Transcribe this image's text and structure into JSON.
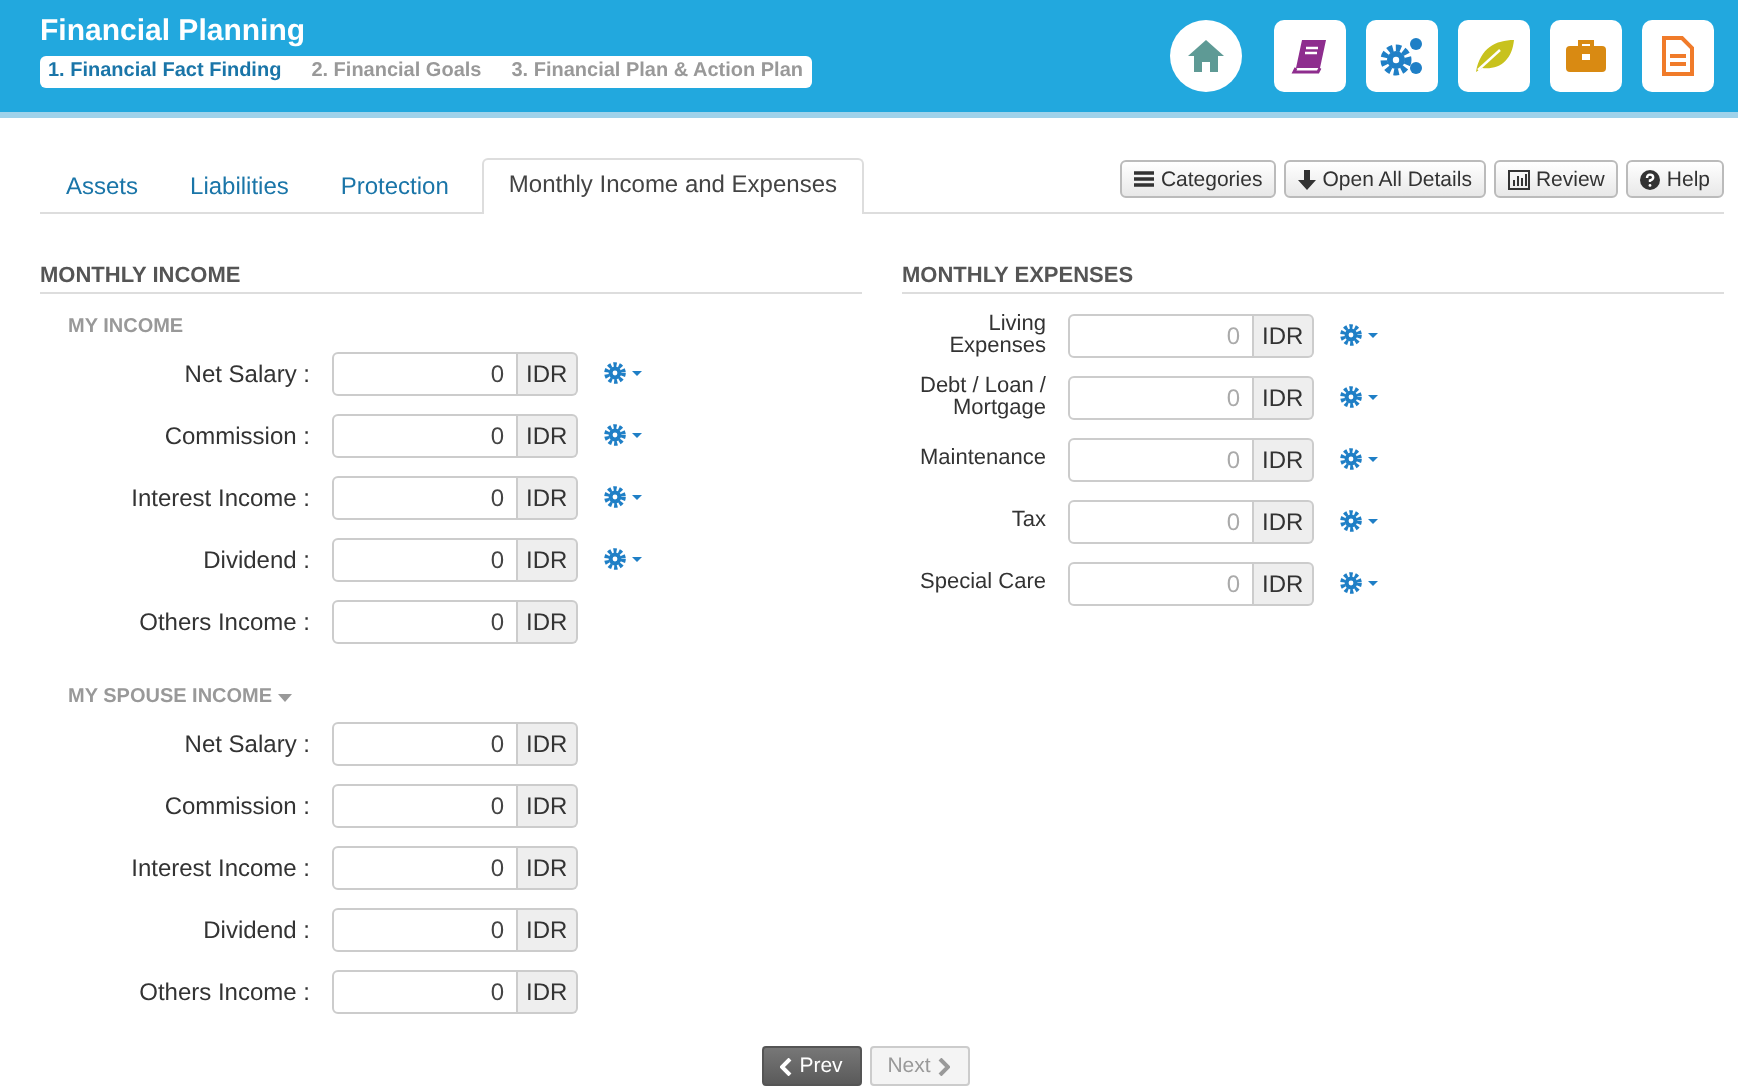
{
  "header": {
    "title": "Financial Planning",
    "steps": [
      {
        "label": "1. Financial Fact Finding",
        "selected": true
      },
      {
        "label": "2. Financial Goals",
        "selected": false
      },
      {
        "label": "3. Financial Plan & Action Plan",
        "selected": false
      }
    ],
    "apps": [
      {
        "kind": "home"
      },
      {
        "kind": "book"
      },
      {
        "kind": "gears"
      },
      {
        "kind": "leaf"
      },
      {
        "kind": "briefcase"
      },
      {
        "kind": "document"
      }
    ]
  },
  "tabs": [
    {
      "label": "Assets",
      "selected": false
    },
    {
      "label": "Liabilities",
      "selected": false
    },
    {
      "label": "Protection",
      "selected": false
    },
    {
      "label": "Monthly Income and Expenses",
      "selected": true
    }
  ],
  "toolbar": [
    {
      "kind": "list",
      "label": "Categories"
    },
    {
      "kind": "down",
      "label": "Open All Details"
    },
    {
      "kind": "chart",
      "label": "Review"
    },
    {
      "kind": "help",
      "label": "Help"
    }
  ],
  "income": {
    "title": "MONTHLY INCOME",
    "groups": [
      {
        "title": "MY INCOME",
        "dropdown": false,
        "rows": [
          {
            "label": "Net Salary :",
            "value": "0",
            "unit": "IDR",
            "gear": true
          },
          {
            "label": "Commission :",
            "value": "0",
            "unit": "IDR",
            "gear": true
          },
          {
            "label": "Interest Income :",
            "value": "0",
            "unit": "IDR",
            "gear": true
          },
          {
            "label": "Dividend :",
            "value": "0",
            "unit": "IDR",
            "gear": true
          },
          {
            "label": "Others Income :",
            "value": "0",
            "unit": "IDR",
            "gear": false
          }
        ]
      },
      {
        "title": "MY SPOUSE INCOME",
        "dropdown": true,
        "rows": [
          {
            "label": "Net Salary :",
            "value": "0",
            "unit": "IDR",
            "gear": false
          },
          {
            "label": "Commission :",
            "value": "0",
            "unit": "IDR",
            "gear": false
          },
          {
            "label": "Interest Income :",
            "value": "0",
            "unit": "IDR",
            "gear": false
          },
          {
            "label": "Dividend :",
            "value": "0",
            "unit": "IDR",
            "gear": false
          },
          {
            "label": "Others Income :",
            "value": "0",
            "unit": "IDR",
            "gear": false
          }
        ]
      }
    ]
  },
  "expenses": {
    "title": "MONTHLY EXPENSES",
    "rows": [
      {
        "label": "Living Expenses",
        "placeholder": "0",
        "unit": "IDR",
        "gear": true
      },
      {
        "label": "Debt / Loan / Mortgage",
        "placeholder": "0",
        "unit": "IDR",
        "gear": true
      },
      {
        "label": "Maintenance",
        "placeholder": "0",
        "unit": "IDR",
        "gear": true
      },
      {
        "label": "Tax",
        "placeholder": "0",
        "unit": "IDR",
        "gear": true
      },
      {
        "label": "Special Care",
        "placeholder": "0",
        "unit": "IDR",
        "gear": true
      }
    ]
  },
  "pager": [
    {
      "kind": "prev",
      "label": "Prev",
      "disabled": false
    },
    {
      "kind": "next",
      "label": "Next",
      "disabled": true
    }
  ]
}
